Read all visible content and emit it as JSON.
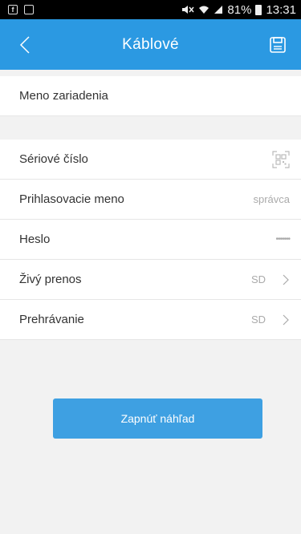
{
  "status_bar": {
    "battery": "81%",
    "time": "13:31"
  },
  "app_bar": {
    "title": "Káblové"
  },
  "rows": {
    "device_name": {
      "label": "Meno zariadenia"
    },
    "serial": {
      "label": "Sériové číslo"
    },
    "login": {
      "label": "Prihlasovacie meno",
      "value": "správca"
    },
    "password": {
      "label": "Heslo",
      "value": "•••••••"
    },
    "live": {
      "label": "Živý prenos",
      "value": "SD"
    },
    "playback": {
      "label": "Prehrávanie",
      "value": "SD"
    }
  },
  "actions": {
    "preview_button": "Zapnúť náhľad"
  },
  "icons": {
    "back": "chevron-left-icon",
    "save": "save-icon",
    "scan": "qr-scan-icon",
    "chevron": "chevron-right-icon"
  },
  "colors": {
    "app_bar": "#2b99e2",
    "button": "#3ea0e2",
    "background": "#f2f2f2"
  }
}
